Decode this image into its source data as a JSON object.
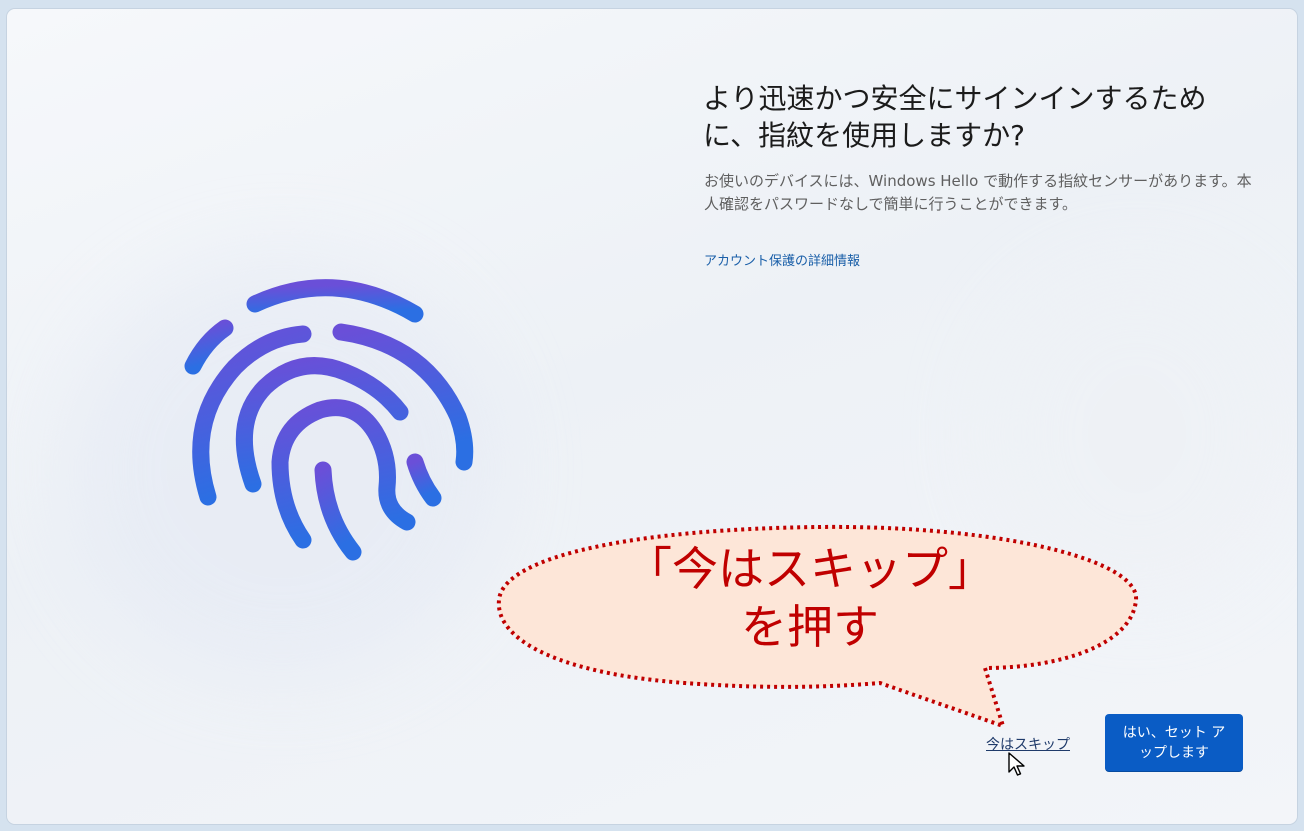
{
  "main": {
    "title": "より迅速かつ安全にサインインするために、指紋を使用しますか?",
    "description": "お使いのデバイスには、Windows Hello で動作する指紋センサーがあります。本人確認をパスワードなしで簡単に行うことができます。",
    "link_label": "アカウント保護の詳細情報"
  },
  "callout": {
    "line1": "「今はスキップ」",
    "line2": "を押す",
    "color": "#c00000",
    "fill": "#fde6d8"
  },
  "actions": {
    "skip_label": "今はスキップ",
    "setup_label": "はい、セット アップします"
  },
  "icons": {
    "illustration": "fingerprint-icon",
    "pointer": "mouse-cursor-icon"
  },
  "colors": {
    "accent": "#0a5cc5",
    "fingerprint_top": "#5b4fd6",
    "fingerprint_bottom": "#2a6fe0"
  }
}
